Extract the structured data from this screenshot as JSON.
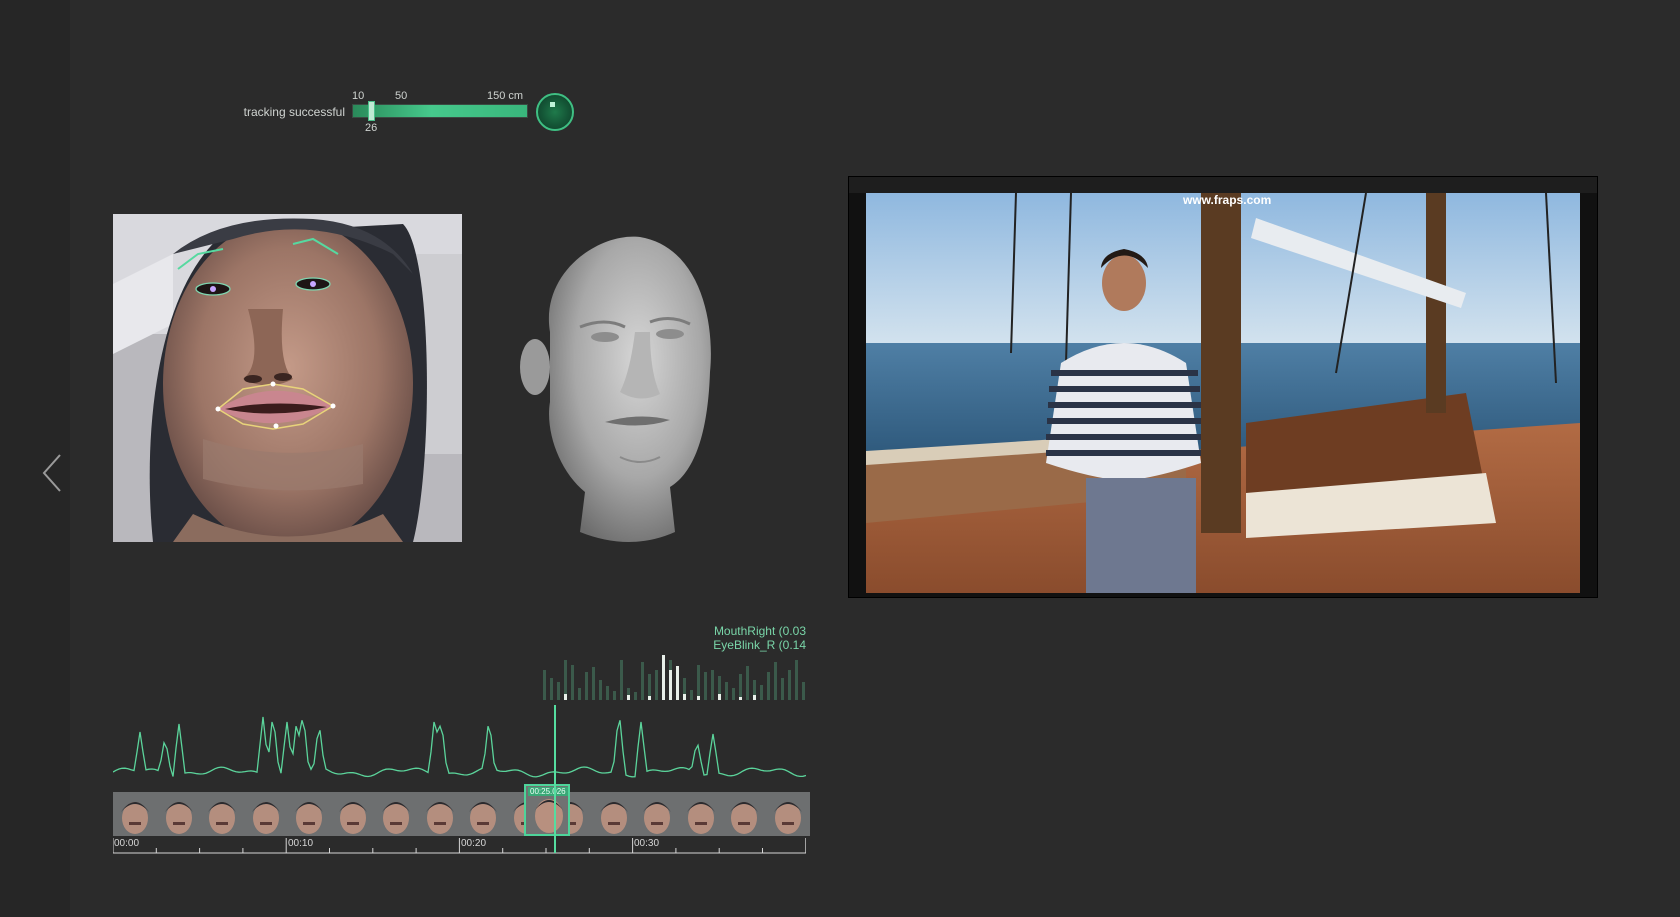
{
  "tracking": {
    "status": "tracking successful",
    "scale_labels": {
      "min": "10",
      "mid": "50",
      "max": "150 cm",
      "current": "26"
    },
    "distance_fraction": 0.09
  },
  "video": {
    "watermark": "www.fraps.com"
  },
  "timeline": {
    "blendshape_labels": [
      "MouthRight (0.03",
      "EyeBlink_R (0.14"
    ],
    "selected_thumb_time": "00:25.026",
    "time_labels": [
      "00:00",
      "00:10",
      "00:20",
      "00:30"
    ],
    "playhead_fraction": 0.64
  },
  "colors": {
    "accent": "#46c98c",
    "background": "#2b2b2b",
    "curve": "#5bd49b"
  },
  "icons": {
    "back": "chevron-left-icon",
    "orb": "tracking-orb-icon"
  }
}
